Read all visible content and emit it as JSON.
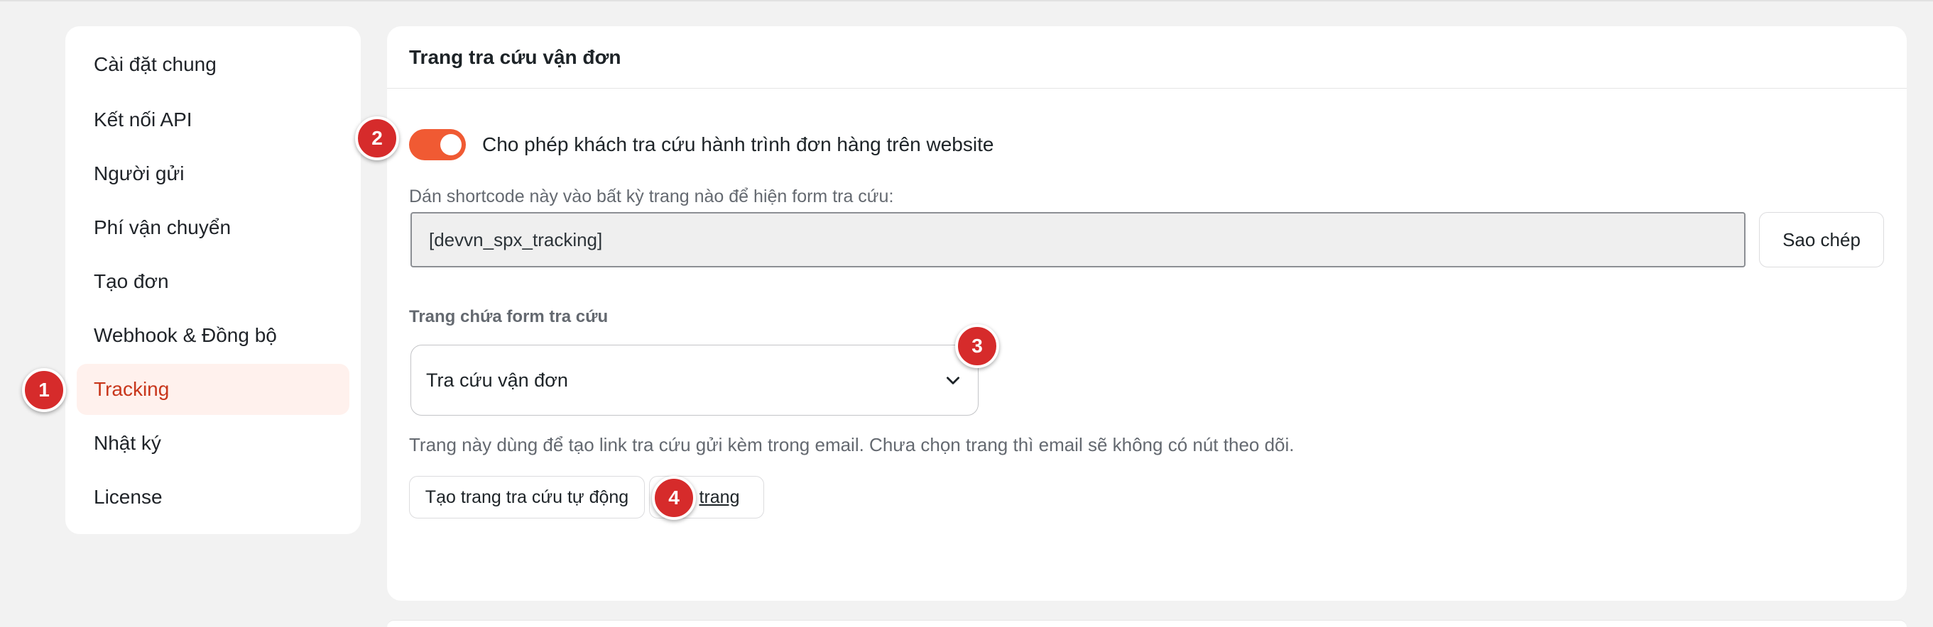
{
  "sidebar": {
    "items": [
      {
        "label": "Cài đặt chung"
      },
      {
        "label": "Kết nối API"
      },
      {
        "label": "Người gửi"
      },
      {
        "label": "Phí vận chuyển"
      },
      {
        "label": "Tạo đơn"
      },
      {
        "label": "Webhook & Đồng bộ"
      },
      {
        "label": "Tracking",
        "active": true
      },
      {
        "label": "Nhật ký"
      },
      {
        "label": "License"
      }
    ]
  },
  "panel": {
    "title": "Trang tra cứu vận đơn",
    "toggle": {
      "label": "Cho phép khách tra cứu hành trình đơn hàng trên website",
      "enabled": true
    },
    "shortcode": {
      "hint": "Dán shortcode này vào bất kỳ trang nào để hiện form tra cứu:",
      "value": "[devvn_spx_tracking]",
      "copy_label": "Sao chép"
    },
    "page_select": {
      "label": "Trang chứa form tra cứu",
      "selected": "Tra cứu vận đơn",
      "help": "Trang này dùng để tạo link tra cứu gửi kèm trong email. Chưa chọn trang thì email sẽ không có nút theo dõi."
    },
    "buttons": {
      "create_label": "Tạo trang tra cứu tự động",
      "view_label": "trang"
    }
  },
  "markers": [
    "1",
    "2",
    "3",
    "4"
  ],
  "colors": {
    "accent": "#f05a33",
    "active_text": "#c8361b",
    "active_bg": "#fff1ed",
    "marker": "#d62b2b"
  }
}
